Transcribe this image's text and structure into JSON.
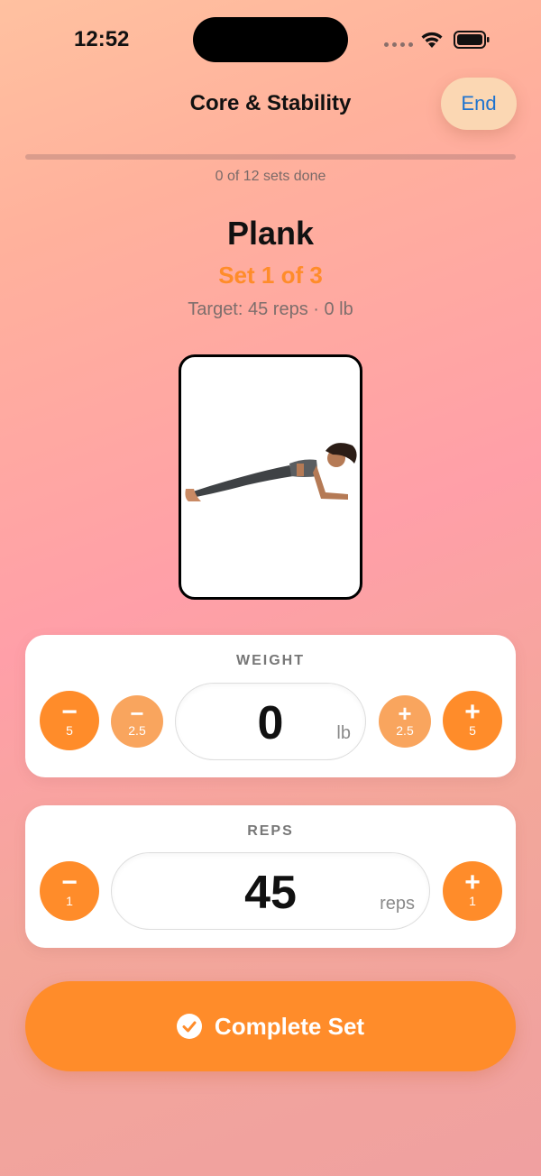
{
  "status_bar": {
    "time": "12:52"
  },
  "header": {
    "title": "Core & Stability",
    "end_label": "End"
  },
  "progress": {
    "completed_sets": 0,
    "total_sets": 12,
    "fraction": 0.0,
    "label": "0 of 12 sets done"
  },
  "exercise": {
    "name": "Plank",
    "set_label": "Set 1 of 3",
    "target": "Target: 45 reps · 0 lb"
  },
  "weight": {
    "title": "WEIGHT",
    "value": "0",
    "unit": "lb",
    "dec_big": "5",
    "dec_small": "2.5",
    "inc_small": "2.5",
    "inc_big": "5"
  },
  "reps": {
    "title": "REPS",
    "value": "45",
    "unit": "reps",
    "dec": "1",
    "inc": "1"
  },
  "complete_label": "Complete Set",
  "colors": {
    "accent": "#ff8c2a",
    "accent_light": "#f9a55e",
    "link": "#1e73cf"
  },
  "icons": [
    "check-circle-icon",
    "wifi-icon",
    "battery-icon",
    "signal-icon",
    "minus-icon",
    "plus-icon"
  ]
}
